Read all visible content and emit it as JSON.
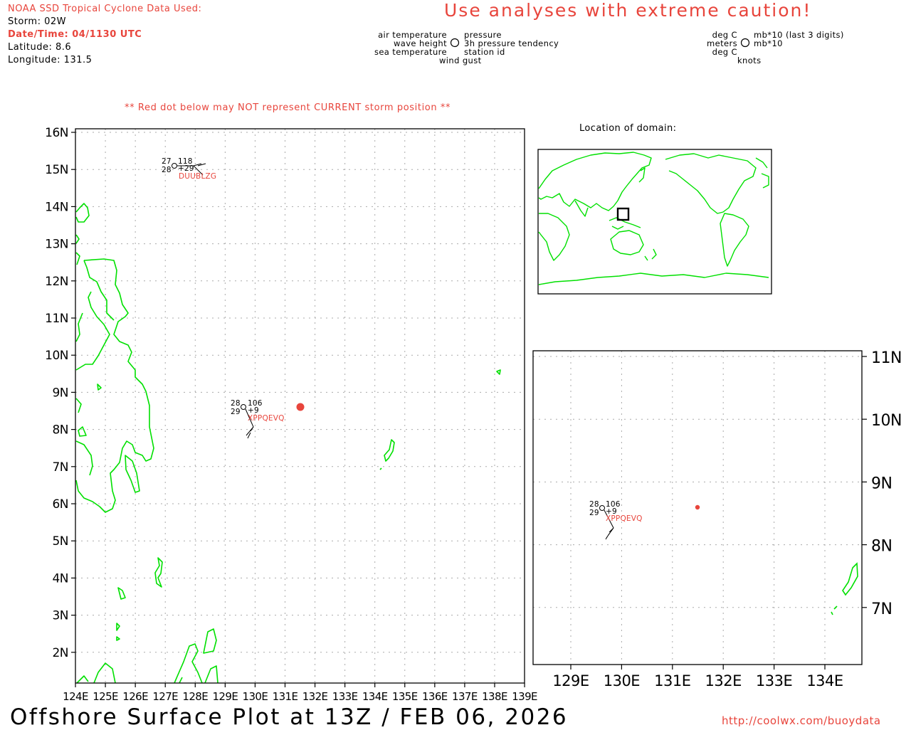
{
  "header": {
    "source": "NOAA SSD Tropical Cyclone Data Used:",
    "storm": "Storm: 02W",
    "datetime": "Date/Time: 04/1130 UTC",
    "latitude": "Latitude: 8.6",
    "longitude": "Longitude: 131.5",
    "caution": "Use analyses with extreme caution!"
  },
  "legend": {
    "air_temperature": "air temperature",
    "wave_height": "wave height",
    "sea_temperature": "sea temperature",
    "wind_gust": "wind gust",
    "pressure": "pressure",
    "pressure_tendency": "3h pressure tendency",
    "station_id": "station id",
    "units_left_1": "deg C",
    "units_left_2": "meters",
    "units_left_3": "deg C",
    "units_right_1": "mb*10 (last 3 digits)",
    "units_right_2": "mb*10",
    "units_right_3": "knots"
  },
  "warning": "** Red dot below may NOT represent CURRENT storm position **",
  "inset_title": "Location of domain:",
  "main_map": {
    "lat_labels": [
      "16N",
      "15N",
      "14N",
      "13N",
      "12N",
      "11N",
      "10N",
      "9N",
      "8N",
      "7N",
      "6N",
      "5N",
      "4N",
      "3N",
      "2N"
    ],
    "lon_labels": [
      "124E",
      "125E",
      "126E",
      "127E",
      "128E",
      "129E",
      "130E",
      "131E",
      "132E",
      "133E",
      "134E",
      "135E",
      "136E",
      "137E",
      "138E",
      "139E"
    ]
  },
  "zoom_map": {
    "lat_labels": [
      "11N",
      "10N",
      "9N",
      "8N",
      "7N"
    ],
    "lon_labels": [
      "129E",
      "130E",
      "131E",
      "132E",
      "133E",
      "134E"
    ]
  },
  "stations": [
    {
      "air_temp": "27",
      "sea_temp": "28",
      "pressure": "118",
      "tendency": "+29",
      "id": "DUUBLZG"
    },
    {
      "air_temp": "28",
      "sea_temp": "29",
      "pressure": "106",
      "tendency": "+9",
      "id": "XPPQEVQ"
    }
  ],
  "storm_position": {
    "lat": 8.6,
    "lon": 131.5
  },
  "footer": {
    "title": "Offshore Surface Plot at 13Z / FEB 06, 2026",
    "url": "http://coolwx.com/buoydata"
  },
  "colors": {
    "coast": "#00e000",
    "storm": "#e8453c",
    "grid": "#aaaaaa"
  }
}
